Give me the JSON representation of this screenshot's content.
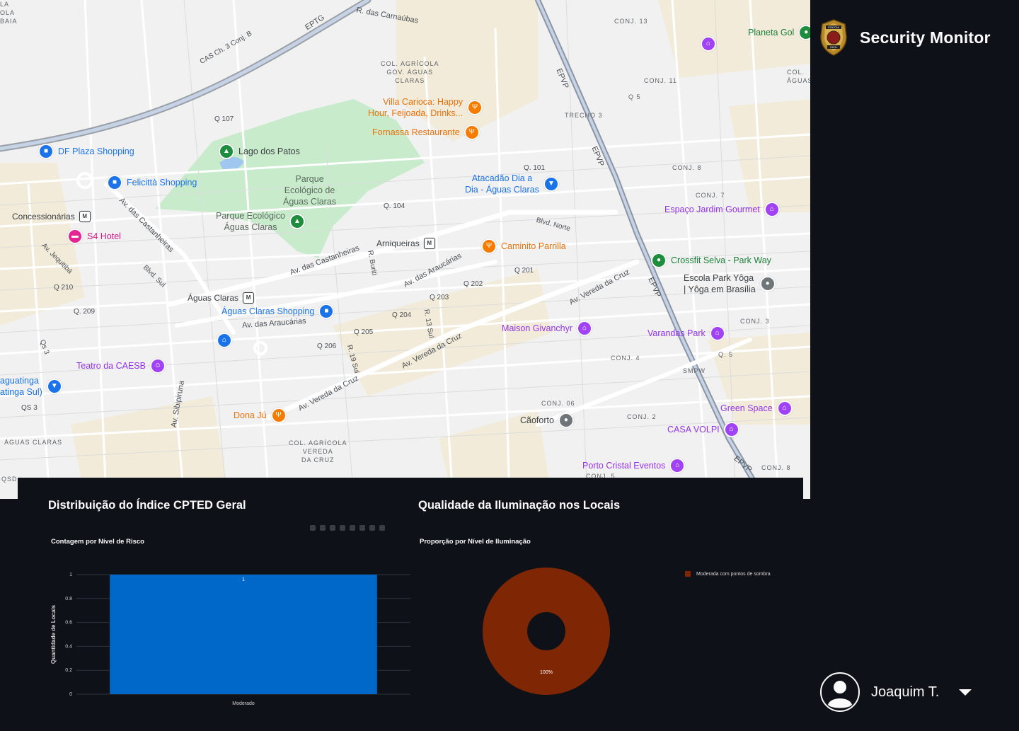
{
  "sidebar": {
    "title": "Security Monitor",
    "logo_icon": "policia-civil-badge-icon",
    "logo_text": [
      "POLÍCIA",
      "CIVIL"
    ],
    "user": {
      "name": "Joaquim T.",
      "avatar_icon": "user-avatar-icon",
      "menu_icon": "caret-down-icon"
    }
  },
  "map": {
    "roads": [
      {
        "id": "r1",
        "text": "R. das Carnaúbas"
      },
      {
        "id": "r2",
        "text": "EPTG"
      },
      {
        "id": "r3",
        "text": "CAS Ch. 3 Conj. B"
      },
      {
        "id": "r4",
        "text": "Q 107"
      },
      {
        "id": "r5",
        "text": "Av. das Castanheiras"
      },
      {
        "id": "r6",
        "text": "Av. Jequitibá"
      },
      {
        "id": "r7",
        "text": "Blvd. Sul"
      },
      {
        "id": "r8",
        "text": "Q 210"
      },
      {
        "id": "r9",
        "text": "Q. 209"
      },
      {
        "id": "r10",
        "text": "Qs 3"
      },
      {
        "id": "r11",
        "text": "QS 3"
      },
      {
        "id": "r12",
        "text": "Av. Sibipiruna"
      },
      {
        "id": "r13",
        "text": "Av. das Castanheiras"
      },
      {
        "id": "r14",
        "text": "R. Buriti"
      },
      {
        "id": "r15",
        "text": "Av. das Araucárias"
      },
      {
        "id": "r16",
        "text": "Av. das Araucárias"
      },
      {
        "id": "r17",
        "text": "Q. 104"
      },
      {
        "id": "r18",
        "text": "Q. 101"
      },
      {
        "id": "r19",
        "text": "Blvd. Norte"
      },
      {
        "id": "r20",
        "text": "Q 201"
      },
      {
        "id": "r21",
        "text": "Q 202"
      },
      {
        "id": "r22",
        "text": "Q 203"
      },
      {
        "id": "r23",
        "text": "Q 204"
      },
      {
        "id": "r24",
        "text": "R. 13 Sul"
      },
      {
        "id": "r25",
        "text": "Q 205"
      },
      {
        "id": "r26",
        "text": "Q 206"
      },
      {
        "id": "r27",
        "text": "R. 19 Sul"
      },
      {
        "id": "r28",
        "text": "Av. Vereda da Cruz"
      },
      {
        "id": "r29",
        "text": "Av. Vereda da Cruz"
      },
      {
        "id": "r30",
        "text": "Av. Vereda da Cruz"
      },
      {
        "id": "r31",
        "text": "EPVP"
      },
      {
        "id": "r32",
        "text": "EPVP"
      },
      {
        "id": "r33",
        "text": "EPVP"
      },
      {
        "id": "r34",
        "text": "EPVP"
      },
      {
        "id": "r35",
        "text": "TRECHO 3"
      },
      {
        "id": "r36",
        "text": "Q 5"
      },
      {
        "id": "r37",
        "text": "Q. 5"
      },
      {
        "id": "r38",
        "text": "SMPW"
      }
    ],
    "areas": [
      {
        "id": "a1",
        "text": "COL. AGRÍCOLA\nGOV. ÁGUAS\nCLARAS"
      },
      {
        "id": "a2",
        "text": "CONJ. 13"
      },
      {
        "id": "a3",
        "text": "CONJ. 11"
      },
      {
        "id": "a4",
        "text": "CONJ. 8"
      },
      {
        "id": "a5",
        "text": "CONJ. 7"
      },
      {
        "id": "a6",
        "text": "CONJ. 3"
      },
      {
        "id": "a7",
        "text": "CONJ. 4"
      },
      {
        "id": "a8",
        "text": "CONJ. 06"
      },
      {
        "id": "a9",
        "text": "CONJ. 2"
      },
      {
        "id": "a10",
        "text": "CONJ. 8"
      },
      {
        "id": "a11",
        "text": "COL. AGRÍCOLA\nVEREDA\nDA CRUZ"
      },
      {
        "id": "a12",
        "text": "ÁGUAS CLARAS"
      },
      {
        "id": "a13",
        "text": "COL.\nÁGUAS"
      },
      {
        "id": "a14",
        "text": "QSD"
      },
      {
        "id": "a15",
        "text": "LA\nOLA\nBAIA"
      },
      {
        "id": "a16",
        "text": "CONJ. 5"
      }
    ],
    "pois": [
      {
        "id": "p1",
        "text": "DF Plaza Shopping",
        "kind": "shop",
        "icon": "shopping-bag-icon"
      },
      {
        "id": "p2",
        "text": "Felicittà Shopping",
        "kind": "shop",
        "icon": "shopping-bag-icon"
      },
      {
        "id": "p3",
        "text": "Lago dos Patos",
        "kind": "dark",
        "icon": "tree-icon"
      },
      {
        "id": "p4",
        "text": "Villa Carioca: Happy\nHour, Feijoada, Drinks...",
        "kind": "food",
        "icon": "restaurant-icon"
      },
      {
        "id": "p5",
        "text": "Fornassa Restaurante",
        "kind": "food",
        "icon": "restaurant-icon"
      },
      {
        "id": "p6",
        "text": "Atacadão Dia a\nDia - Águas Claras",
        "kind": "shop",
        "icon": "shopping-cart-icon"
      },
      {
        "id": "p7",
        "text": "Planeta Gol",
        "kind": "park",
        "icon": "sports-icon"
      },
      {
        "id": "p8",
        "text": "Espaço Jardim Gourmet",
        "kind": "evt",
        "icon": "event-venue-icon"
      },
      {
        "id": "p9",
        "text": "Concessionárias",
        "kind": "dark",
        "icon": "metro-icon"
      },
      {
        "id": "p10",
        "text": "S4 Hotel",
        "kind": "hot",
        "icon": "hotel-icon"
      },
      {
        "id": "p11",
        "text": "Arniqueiras",
        "kind": "dark",
        "icon": "metro-icon"
      },
      {
        "id": "p12",
        "text": "Caminito Parrilla",
        "kind": "food",
        "icon": "restaurant-icon"
      },
      {
        "id": "p13",
        "text": "Crossfit Selva - Park Way",
        "kind": "park",
        "icon": "fitness-icon"
      },
      {
        "id": "p14",
        "text": "Escola Park Yôga\n| Yôga em Brasília",
        "kind": "gray",
        "icon": "place-icon"
      },
      {
        "id": "p15",
        "text": "Águas Claras",
        "kind": "dark",
        "icon": "metro-icon"
      },
      {
        "id": "p16",
        "text": "Águas Claras Shopping",
        "kind": "shop",
        "icon": "shopping-bag-icon"
      },
      {
        "id": "p17",
        "text": "Av. das Araucárias",
        "kind": "road",
        "icon": "home-icon"
      },
      {
        "id": "p18",
        "text": "Maison Givanchyr",
        "kind": "evt",
        "icon": "event-venue-icon"
      },
      {
        "id": "p19",
        "text": "Varandas Park",
        "kind": "evt",
        "icon": "event-venue-icon"
      },
      {
        "id": "p20",
        "text": "Teatro da CAESB",
        "kind": "evt",
        "icon": "theater-icon"
      },
      {
        "id": "p21",
        "text": "aguatinga\natinga Sul)",
        "kind": "shop",
        "icon": "shopping-cart-icon"
      },
      {
        "id": "p22",
        "text": "Dona Jú",
        "kind": "food",
        "icon": "restaurant-icon"
      },
      {
        "id": "p23",
        "text": "Cãoforto",
        "kind": "gray",
        "icon": "place-icon"
      },
      {
        "id": "p24",
        "text": "Green Space",
        "kind": "evt",
        "icon": "event-venue-icon"
      },
      {
        "id": "p25",
        "text": "CASA VOLPI",
        "kind": "evt",
        "icon": "event-venue-icon"
      },
      {
        "id": "p26",
        "text": "Porto Cristal Eventos",
        "kind": "evt",
        "icon": "event-venue-icon"
      },
      {
        "id": "p27",
        "text": "Parque\nEcológico de\nÁguas Claras",
        "kind": "park-label",
        "icon": ""
      },
      {
        "id": "p28",
        "text": "Parque Ecológico\nÁguas Claras",
        "kind": "park",
        "icon": "tree-icon"
      }
    ]
  },
  "charts": {
    "left_title": "Distribuição do Índice CPTED Geral",
    "right_title": "Qualidade da Iluminação nos Locais"
  },
  "chart_data": [
    {
      "type": "bar",
      "title": "Contagem por Nível de Risco",
      "categories": [
        "Moderado"
      ],
      "values": [
        1
      ],
      "data_labels": [
        "1"
      ],
      "xlabel": "",
      "ylabel": "Quantidade de Locais",
      "ylim": [
        0,
        1
      ],
      "yticks": [
        "0",
        "0.2",
        "0.4",
        "0.6",
        "0.8",
        "1"
      ],
      "grid": true,
      "color": "#0068c9"
    },
    {
      "type": "pie",
      "title": "Proporção por Nível de Iluminação",
      "donut": true,
      "labels": [
        "Moderada com pontos de sombra"
      ],
      "values": [
        100
      ],
      "data_labels": [
        "100%"
      ],
      "colors": [
        "#7f2704"
      ],
      "legend": "top-right"
    }
  ]
}
